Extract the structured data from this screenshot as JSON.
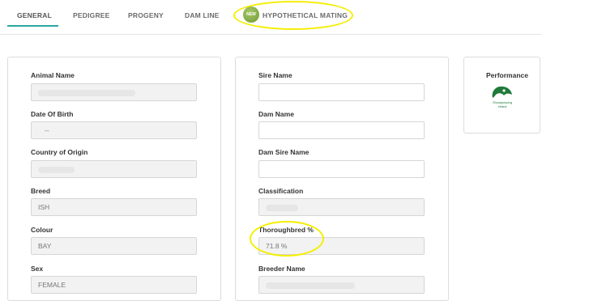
{
  "tabs": {
    "general": "GENERAL",
    "pedigree": "PEDIGREE",
    "progeny": "PROGENY",
    "dam_line": "DAM LINE",
    "hypothetical_mating": "HYPOTHETICAL MATING",
    "new_badge": "NEW"
  },
  "left_card": {
    "animal_name_label": "Animal Name",
    "dob_label": "Date Of Birth",
    "dob_value": "--",
    "country_label": "Country of Origin",
    "breed_label": "Breed",
    "breed_value": "ISH",
    "colour_label": "Colour",
    "colour_value": "BAY",
    "sex_label": "Sex",
    "sex_value": "FEMALE"
  },
  "middle_card": {
    "sire_label": "Sire Name",
    "dam_label": "Dam Name",
    "dam_sire_label": "Dam Sire Name",
    "classification_label": "Classification",
    "thoroughbred_label": "Thoroughbred %",
    "thoroughbred_value": "71.8 %",
    "breeder_label": "Breeder Name"
  },
  "performance": {
    "title": "Performance",
    "logo_text_1": "Showjumping",
    "logo_text_2": "Ireland",
    "logo_icon": "horse-head-icon"
  },
  "colors": {
    "accent": "#2aa7a1",
    "highlight": "#f4ee00",
    "badge": "#7ea63a",
    "logo": "#1f7a3a"
  }
}
